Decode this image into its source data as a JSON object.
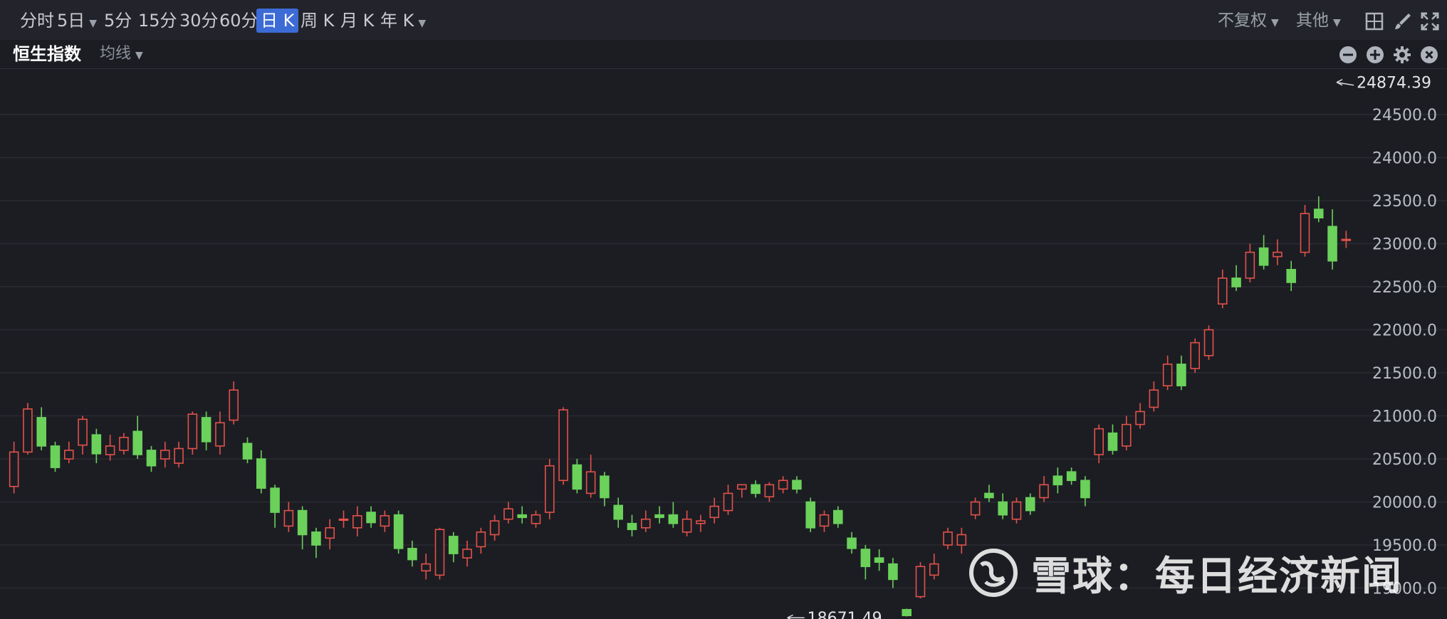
{
  "toolbar": {
    "periods": [
      {
        "label": "分时"
      },
      {
        "label": "5日",
        "dropdown": true
      },
      {
        "label": "5分"
      },
      {
        "label": "15分"
      },
      {
        "label": "30分"
      },
      {
        "label": "60分"
      },
      {
        "label": "日 K",
        "active": true
      },
      {
        "label": "周 K"
      },
      {
        "label": "月 K"
      },
      {
        "label": "年 K",
        "dropdown": true
      }
    ],
    "adjust_label": "不复权",
    "other_label": "其他"
  },
  "pane": {
    "title": "恒生指数",
    "ma_label": "均线"
  },
  "chart_data": {
    "type": "candlestick",
    "yticks": [
      "19000.0",
      "19500.0",
      "20000.0",
      "20500.0",
      "21000.0",
      "21500.0",
      "22000.0",
      "22500.0",
      "23000.0",
      "23500.0",
      "24000.0",
      "24500.0"
    ],
    "ylim": [
      18600,
      25050
    ],
    "grid": true,
    "up_color": "#e2514a",
    "down_color": "#6bd15b",
    "annotations": [
      {
        "label": "24874.39",
        "value": 24874.39,
        "candle": 96
      },
      {
        "label": "18671.49",
        "value": 18671.49,
        "candle": 56
      }
    ],
    "candles": [
      [
        20180,
        20580,
        20100,
        20700
      ],
      [
        20580,
        21080,
        20550,
        21150
      ],
      [
        20980,
        20650,
        20600,
        21100
      ],
      [
        20650,
        20400,
        20350,
        20700
      ],
      [
        20500,
        20600,
        20450,
        20700
      ],
      [
        20660,
        20960,
        20550,
        21000
      ],
      [
        20780,
        20560,
        20450,
        20850
      ],
      [
        20550,
        20650,
        20480,
        20780
      ],
      [
        20600,
        20750,
        20550,
        20800
      ],
      [
        20820,
        20550,
        20500,
        21000
      ],
      [
        20600,
        20420,
        20350,
        20650
      ],
      [
        20500,
        20600,
        20400,
        20700
      ],
      [
        20450,
        20620,
        20400,
        20700
      ],
      [
        20620,
        21020,
        20550,
        21050
      ],
      [
        20980,
        20700,
        20600,
        21050
      ],
      [
        20650,
        20920,
        20550,
        21050
      ],
      [
        20950,
        21300,
        20900,
        21400
      ],
      [
        20680,
        20500,
        20450,
        20750
      ],
      [
        20500,
        20160,
        20100,
        20600
      ],
      [
        20160,
        19880,
        19700,
        20200
      ],
      [
        19720,
        19900,
        19650,
        20000
      ],
      [
        19900,
        19620,
        19450,
        19950
      ],
      [
        19650,
        19500,
        19350,
        19700
      ],
      [
        19580,
        19700,
        19450,
        19800
      ],
      [
        19800,
        19800,
        19700,
        19900
      ],
      [
        19700,
        19840,
        19600,
        19950
      ],
      [
        19880,
        19760,
        19700,
        19950
      ],
      [
        19720,
        19840,
        19650,
        19900
      ],
      [
        19850,
        19460,
        19400,
        19900
      ],
      [
        19460,
        19330,
        19250,
        19550
      ],
      [
        19200,
        19280,
        19100,
        19400
      ],
      [
        19150,
        19680,
        19100,
        19700
      ],
      [
        19600,
        19400,
        19300,
        19650
      ],
      [
        19350,
        19450,
        19250,
        19550
      ],
      [
        19480,
        19650,
        19400,
        19700
      ],
      [
        19620,
        19780,
        19550,
        19850
      ],
      [
        19800,
        19920,
        19750,
        20000
      ],
      [
        19850,
        19820,
        19750,
        19950
      ],
      [
        19750,
        19850,
        19700,
        19900
      ],
      [
        19880,
        20420,
        19800,
        20500
      ],
      [
        20250,
        21070,
        20200,
        21100
      ],
      [
        20430,
        20150,
        20100,
        20500
      ],
      [
        20100,
        20350,
        20050,
        20550
      ],
      [
        20300,
        20050,
        19950,
        20350
      ],
      [
        19960,
        19800,
        19700,
        20050
      ],
      [
        19750,
        19680,
        19600,
        19850
      ],
      [
        19700,
        19800,
        19650,
        19900
      ],
      [
        19850,
        19820,
        19750,
        19950
      ],
      [
        19850,
        19750,
        19700,
        20000
      ],
      [
        19650,
        19800,
        19600,
        19900
      ],
      [
        19750,
        19780,
        19650,
        19850
      ],
      [
        19820,
        19950,
        19750,
        20050
      ],
      [
        19900,
        20100,
        19850,
        20200
      ],
      [
        20150,
        20200,
        20050,
        20200
      ],
      [
        20200,
        20100,
        20050,
        20250
      ],
      [
        20060,
        20200,
        20000,
        20230
      ],
      [
        20150,
        20250,
        20100,
        20300
      ],
      [
        20250,
        20150,
        20100,
        20300
      ],
      [
        20000,
        19700,
        19650,
        20050
      ],
      [
        19720,
        19850,
        19650,
        19900
      ],
      [
        19900,
        19750,
        19700,
        19950
      ],
      [
        19580,
        19460,
        19400,
        19650
      ],
      [
        19450,
        19250,
        19100,
        19500
      ],
      [
        19350,
        19300,
        19200,
        19450
      ],
      [
        19280,
        19100,
        19000,
        19350
      ],
      [
        18750,
        18680,
        18670,
        18760
      ],
      [
        18900,
        19250,
        18880,
        19300
      ],
      [
        19150,
        19280,
        19100,
        19400
      ],
      [
        19500,
        19650,
        19450,
        19700
      ],
      [
        19500,
        19620,
        19400,
        19700
      ],
      [
        19850,
        20000,
        19800,
        20050
      ],
      [
        20100,
        20050,
        20000,
        20200
      ],
      [
        20000,
        19850,
        19800,
        20100
      ],
      [
        19800,
        20000,
        19750,
        20050
      ],
      [
        20050,
        19900,
        19850,
        20100
      ],
      [
        20050,
        20200,
        20000,
        20300
      ],
      [
        20300,
        20200,
        20100,
        20400
      ],
      [
        20350,
        20250,
        20200,
        20400
      ],
      [
        20250,
        20050,
        19950,
        20300
      ],
      [
        20550,
        20850,
        20450,
        20900
      ],
      [
        20800,
        20600,
        20550,
        20900
      ],
      [
        20650,
        20900,
        20600,
        21000
      ],
      [
        20900,
        21050,
        20850,
        21150
      ],
      [
        21100,
        21300,
        21050,
        21400
      ],
      [
        21350,
        21600,
        21300,
        21700
      ],
      [
        21600,
        21350,
        21300,
        21700
      ],
      [
        21550,
        21850,
        21500,
        21900
      ],
      [
        21700,
        22000,
        21650,
        22050
      ],
      [
        22300,
        22600,
        22250,
        22700
      ],
      [
        22600,
        22500,
        22450,
        22750
      ],
      [
        22600,
        22900,
        22550,
        23000
      ],
      [
        22950,
        22750,
        22700,
        23100
      ],
      [
        22850,
        22900,
        22750,
        23050
      ],
      [
        22700,
        22550,
        22450,
        22800
      ],
      [
        22900,
        23350,
        22850,
        23450
      ],
      [
        23400,
        23300,
        23250,
        23550
      ],
      [
        23200,
        22800,
        22700,
        23400
      ],
      [
        23050,
        23050,
        22950,
        23150
      ]
    ]
  }
}
